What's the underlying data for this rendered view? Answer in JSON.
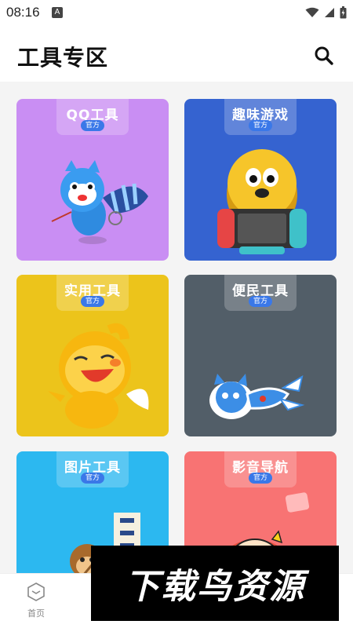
{
  "status_bar": {
    "time": "08:16",
    "app_icon_letter": "A",
    "icons": [
      "wifi-icon",
      "signal-icon",
      "battery-icon"
    ]
  },
  "header": {
    "title": "工具专区",
    "search_icon": "search-icon"
  },
  "cards": [
    {
      "title": "QQ工具",
      "badge": "官方",
      "bg": "#c98ef3",
      "art": "raccoon-mascot"
    },
    {
      "title": "趣味游戏",
      "badge": "官方",
      "bg": "#3563d0",
      "art": "dog-game-console"
    },
    {
      "title": "实用工具",
      "badge": "官方",
      "bg": "#ecc41b",
      "art": "yellow-mascot"
    },
    {
      "title": "便民工具",
      "badge": "官方",
      "bg": "#525e68",
      "art": "cat-lying"
    },
    {
      "title": "图片工具",
      "badge": "官方",
      "bg": "#2cb8f0",
      "art": "monkey-sign"
    },
    {
      "title": "影音导航",
      "badge": "官方",
      "bg": "#f87373",
      "art": "cartoon-face"
    }
  ],
  "bottom_nav": {
    "home_label": "首页",
    "home_icon": "home-hexagon-icon"
  },
  "watermark": {
    "text": "下载鸟资源"
  },
  "colors": {
    "badge": "#3a78e8",
    "content_bg": "#f4f4f4"
  }
}
